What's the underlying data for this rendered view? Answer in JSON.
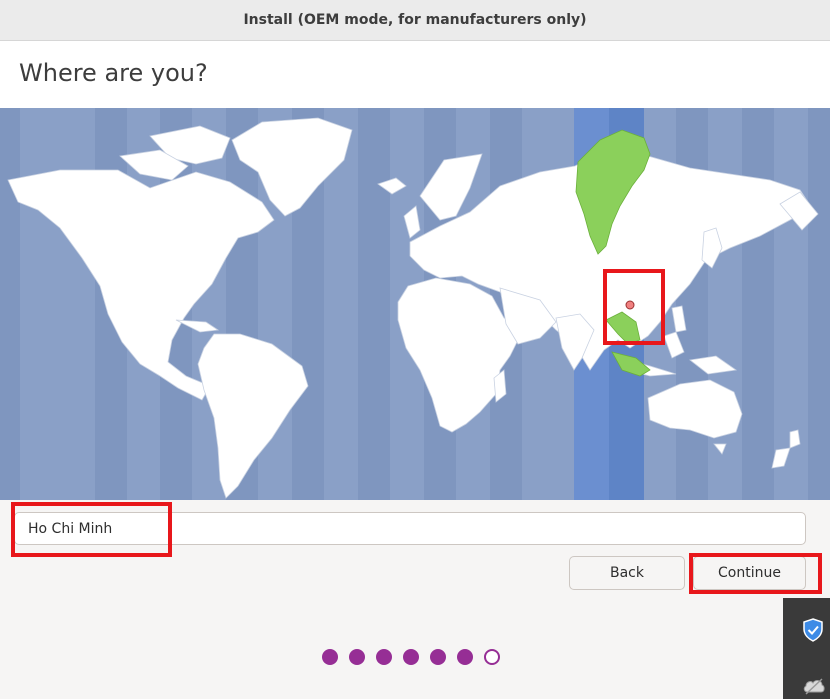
{
  "window": {
    "title": "Install (OEM mode, for manufacturers only)"
  },
  "page": {
    "title": "Where are you?"
  },
  "map": {
    "selected_city": "Ho Chi Minh",
    "colors": {
      "ocean": "#8aa0c7",
      "ocean_stripe": "#7b93bd",
      "land": "#ffffff",
      "timezone_band": "#5e84c6",
      "timezone_land": "#8bd05b",
      "city_marker": "#f08080"
    }
  },
  "location_input": {
    "value": "Ho Chi Minh"
  },
  "buttons": {
    "back_label": "Back",
    "continue_label": "Continue"
  },
  "progress": {
    "total_steps": 7,
    "completed_steps": 6,
    "color": "#962e95"
  },
  "tray": {
    "icons": [
      "shield-check-icon",
      "cloud-icon"
    ]
  },
  "annotations": {
    "highlight_color": "#e8171b"
  }
}
